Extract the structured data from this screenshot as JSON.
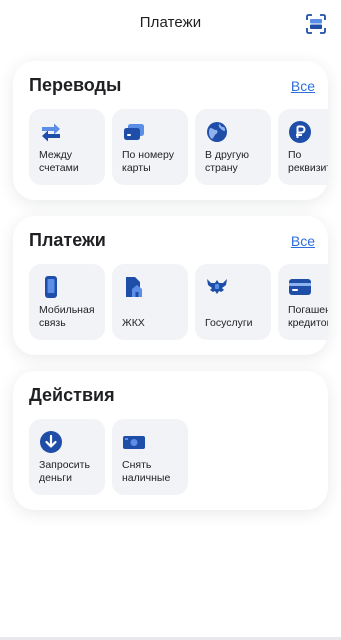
{
  "header": {
    "title": "Платежи"
  },
  "transfers": {
    "title": "Переводы",
    "all_link": "Все",
    "items": [
      {
        "label": "Между\nсчетами",
        "icon": "arrows-swap-icon"
      },
      {
        "label": "По номеру\nкарты",
        "icon": "card-icon"
      },
      {
        "label": "В другую\nстрану",
        "icon": "globe-icon"
      },
      {
        "label": "По\nреквизитам",
        "icon": "ruble-icon"
      }
    ]
  },
  "payments": {
    "title": "Платежи",
    "all_link": "Все",
    "items": [
      {
        "label": "Мобильная\nсвязь",
        "icon": "phone-icon"
      },
      {
        "label": "ЖКХ",
        "icon": "house-icon"
      },
      {
        "label": "Госуслуги",
        "icon": "eagle-icon"
      },
      {
        "label": "Погашение\nкредитов",
        "icon": "credit-card-icon"
      }
    ]
  },
  "actions": {
    "title": "Действия",
    "items": [
      {
        "label": "Запросить\nденьги",
        "icon": "arrow-down-circle-icon"
      },
      {
        "label": "Снять\nналичные",
        "icon": "cash-icon"
      }
    ]
  },
  "colors": {
    "accent": "#2f6fdc",
    "icon_dark": "#1f4ea8",
    "icon_light": "#5b8ee6",
    "tile_bg": "#f1f3f6"
  }
}
